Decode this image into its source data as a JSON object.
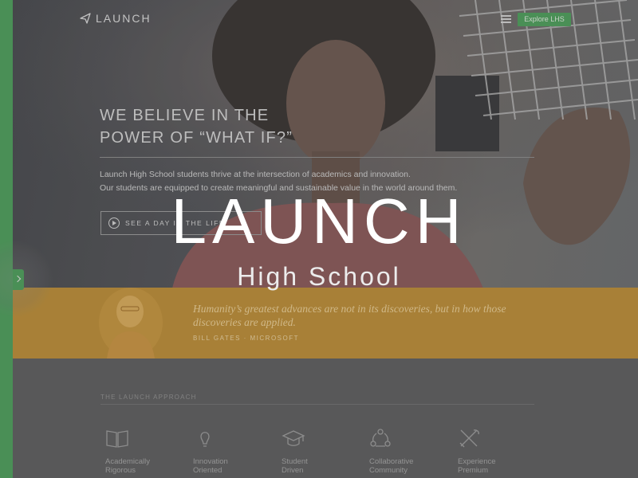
{
  "nav": {
    "logo_text": "LAUNCH",
    "cta_label": "Explore LHS"
  },
  "hero": {
    "headline": "WE BELIEVE IN THE\nPOWER OF “WHAT IF?”",
    "body_line_1": "Launch High School students thrive at the intersection of academics and innovation.",
    "body_line_2": "Our students are equipped to create meaningful and sustainable value in the world around them.",
    "video_button_label": "SEE A DAY IN THE LIFE"
  },
  "overlay": {
    "brand_title": "LAUNCH",
    "brand_subtitle": "High School"
  },
  "quote": {
    "text": "Humanity’s greatest advances are not in its discoveries, but in how those discoveries are applied.",
    "attribution": "BILL GATES · MICROSOFT"
  },
  "approach": {
    "heading": "THE LAUNCH APPROACH",
    "pillars": [
      {
        "label_1": "Academically",
        "label_2": "Rigorous",
        "icon": "book-icon"
      },
      {
        "label_1": "Innovation",
        "label_2": "Oriented",
        "icon": "lightbulb-icon"
      },
      {
        "label_1": "Student",
        "label_2": "Driven",
        "icon": "graduation-cap-icon"
      },
      {
        "label_1": "Collaborative",
        "label_2": "Community",
        "icon": "network-icon"
      },
      {
        "label_1": "Experience",
        "label_2": "Premium",
        "icon": "tools-icon"
      }
    ]
  },
  "colors": {
    "accent_green": "#4f9e5d",
    "quote_gold": "#ba8d3a"
  }
}
